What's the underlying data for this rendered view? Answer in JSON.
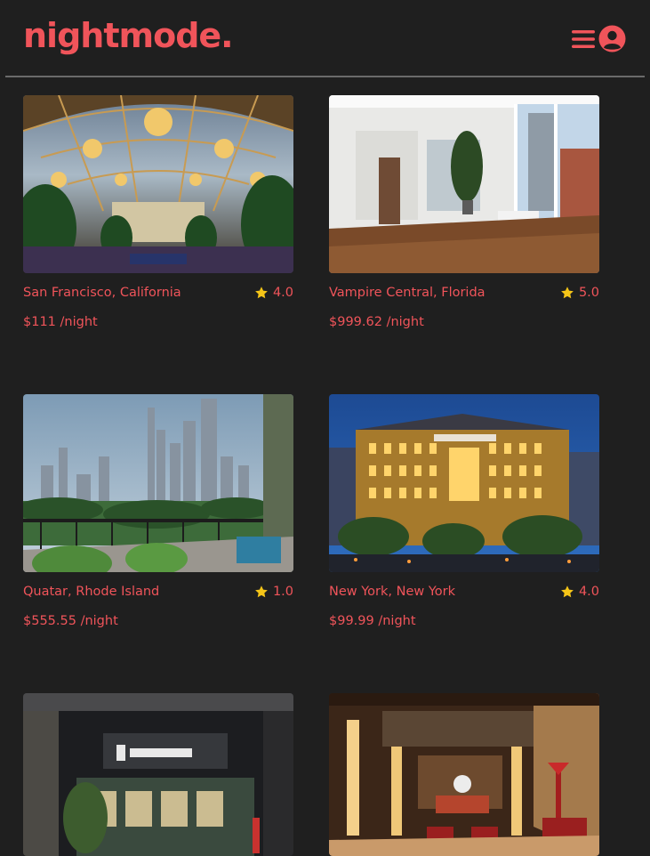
{
  "header": {
    "logo": "nightmode.",
    "menu_icon": "hamburger-menu-icon",
    "account_icon": "user-circle-icon"
  },
  "colors": {
    "background": "#1f1f1f",
    "accent": "#f0545a",
    "star": "#f5c518",
    "divider": "#6a6a6a"
  },
  "listings": [
    {
      "location": "San Francisco, California",
      "rating": "4.0",
      "price": "$111 /night",
      "image": "palace-glass-dome-interior"
    },
    {
      "location": "Vampire Central, Florida",
      "rating": "5.0",
      "price": "$999.62 /night",
      "image": "bright-loft-apartment"
    },
    {
      "location": "Quatar, Rhode Island",
      "rating": "1.0",
      "price": "$555.55 /night",
      "image": "skyline-terrace-view"
    },
    {
      "location": "New York, New York",
      "rating": "4.0",
      "price": "$99.99 /night",
      "image": "hotel-majestic-night"
    },
    {
      "location": "",
      "rating": "",
      "price": "",
      "image": "act-hotel-facade"
    },
    {
      "location": "",
      "rating": "",
      "price": "",
      "image": "art-deco-lobby"
    }
  ]
}
